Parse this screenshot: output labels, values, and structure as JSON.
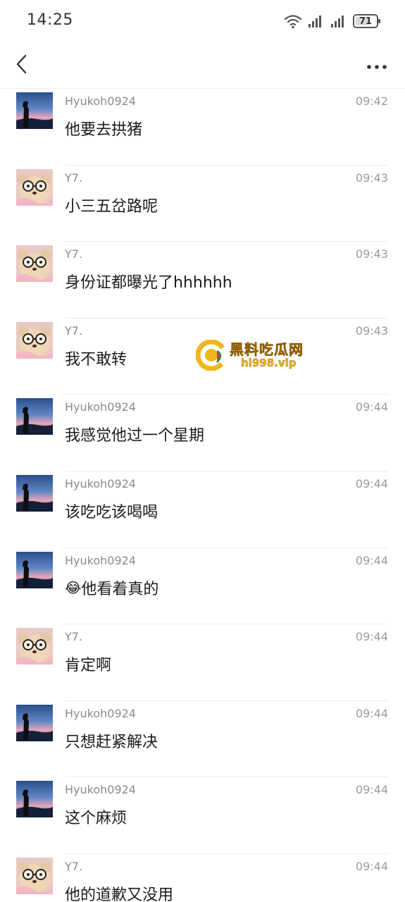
{
  "status_bar": {
    "time": "14:25",
    "battery": "71",
    "battery_level": 0.71
  },
  "header": {
    "back_icon": "chevron-left-icon",
    "more_icon": "more-horizontal-icon"
  },
  "messages": [
    {
      "sender": "Hyukoh0924",
      "time": "09:42",
      "text": "他要去拱猪",
      "avatar": "landscape"
    },
    {
      "sender": "Y7.",
      "time": "09:43",
      "text": "小三五岔路呢",
      "avatar": "glasses"
    },
    {
      "sender": "Y7.",
      "time": "09:43",
      "text": "身份证都曝光了hhhhhh",
      "avatar": "glasses"
    },
    {
      "sender": "Y7.",
      "time": "09:43",
      "text": "我不敢转",
      "avatar": "glasses"
    },
    {
      "sender": "Hyukoh0924",
      "time": "09:44",
      "text": "我感觉他过一个星期",
      "avatar": "landscape"
    },
    {
      "sender": "Hyukoh0924",
      "time": "09:44",
      "text": "该吃吃该喝喝",
      "avatar": "landscape"
    },
    {
      "sender": "Hyukoh0924",
      "time": "09:44",
      "text": "他看着真的",
      "avatar": "landscape",
      "emoji": "😂"
    },
    {
      "sender": "Y7.",
      "time": "09:44",
      "text": "肯定啊",
      "avatar": "glasses"
    },
    {
      "sender": "Hyukoh0924",
      "time": "09:44",
      "text": "只想赶紧解决",
      "avatar": "landscape"
    },
    {
      "sender": "Hyukoh0924",
      "time": "09:44",
      "text": "这个麻烦",
      "avatar": "landscape"
    },
    {
      "sender": "Y7.",
      "time": "09:44",
      "text": "他的道歉又没用",
      "avatar": "glasses"
    }
  ],
  "watermark": {
    "title": "黑料吃瓜网",
    "url": "hl998.vip"
  }
}
